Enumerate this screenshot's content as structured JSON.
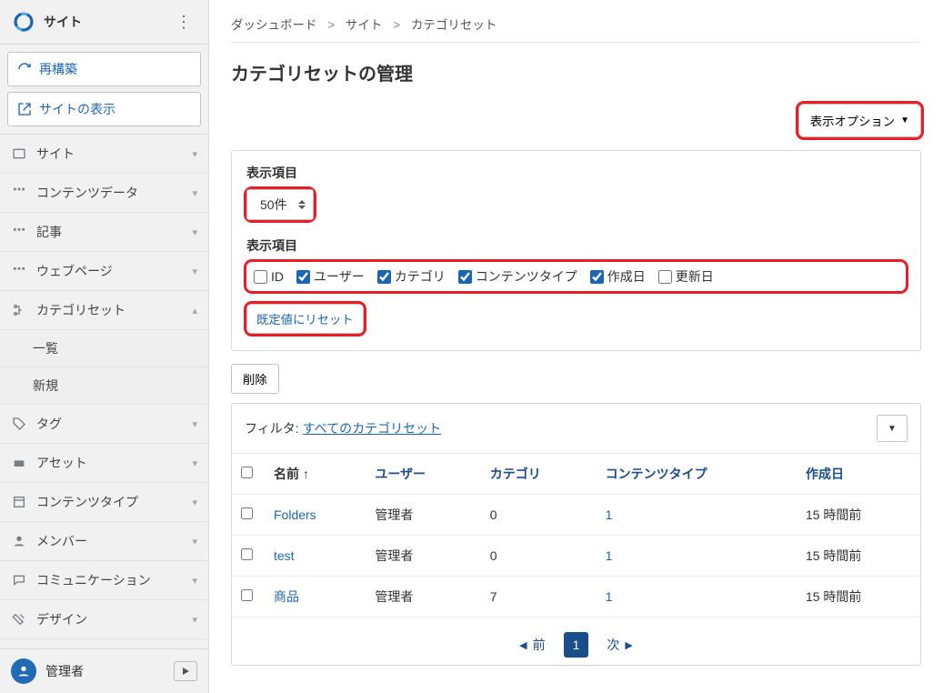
{
  "sidebar": {
    "title": "サイト",
    "actions": {
      "rebuild": "再構築",
      "view_site": "サイトの表示"
    },
    "nav": [
      {
        "key": "site",
        "label": "サイト",
        "chev": "down"
      },
      {
        "key": "content-data",
        "label": "コンテンツデータ",
        "chev": "down"
      },
      {
        "key": "articles",
        "label": "記事",
        "chev": "down"
      },
      {
        "key": "webpages",
        "label": "ウェブページ",
        "chev": "down"
      },
      {
        "key": "category-set",
        "label": "カテゴリセット",
        "chev": "up",
        "sub": [
          {
            "key": "list",
            "label": "一覧"
          },
          {
            "key": "new",
            "label": "新規"
          }
        ]
      },
      {
        "key": "tags",
        "label": "タグ",
        "chev": "down"
      },
      {
        "key": "assets",
        "label": "アセット",
        "chev": "down"
      },
      {
        "key": "content-type",
        "label": "コンテンツタイプ",
        "chev": "down"
      },
      {
        "key": "members",
        "label": "メンバー",
        "chev": "down"
      },
      {
        "key": "communication",
        "label": "コミュニケーション",
        "chev": "down"
      },
      {
        "key": "design",
        "label": "デザイン",
        "chev": "down"
      }
    ],
    "user": "管理者"
  },
  "breadcrumb": [
    "ダッシュボード",
    "サイト",
    "カテゴリセット"
  ],
  "page_title": "カテゴリセットの管理",
  "display_options_label": "表示オプション",
  "options_panel": {
    "section1_label": "表示項目",
    "per_page": "50件",
    "section2_label": "表示項目",
    "columns": [
      {
        "key": "id",
        "label": "ID",
        "checked": false
      },
      {
        "key": "user",
        "label": "ユーザー",
        "checked": true
      },
      {
        "key": "category",
        "label": "カテゴリ",
        "checked": true
      },
      {
        "key": "content_type",
        "label": "コンテンツタイプ",
        "checked": true
      },
      {
        "key": "created",
        "label": "作成日",
        "checked": true
      },
      {
        "key": "updated",
        "label": "更新日",
        "checked": false
      }
    ],
    "reset_label": "既定値にリセット"
  },
  "actions": {
    "delete": "削除"
  },
  "filter": {
    "label": "フィルタ:",
    "current": "すべてのカテゴリセット"
  },
  "table": {
    "headers": {
      "name": "名前",
      "sort_arrow": "↑",
      "user": "ユーザー",
      "category": "カテゴリ",
      "content_type": "コンテンツタイプ",
      "created": "作成日"
    },
    "rows": [
      {
        "name": "Folders",
        "user": "管理者",
        "category": "0",
        "content_type": "1",
        "created": "15 時間前"
      },
      {
        "name": "test",
        "user": "管理者",
        "category": "0",
        "content_type": "1",
        "created": "15 時間前"
      },
      {
        "name": "商品",
        "user": "管理者",
        "category": "7",
        "content_type": "1",
        "created": "15 時間前"
      }
    ]
  },
  "pagination": {
    "prev": "前",
    "page": "1",
    "next": "次"
  }
}
